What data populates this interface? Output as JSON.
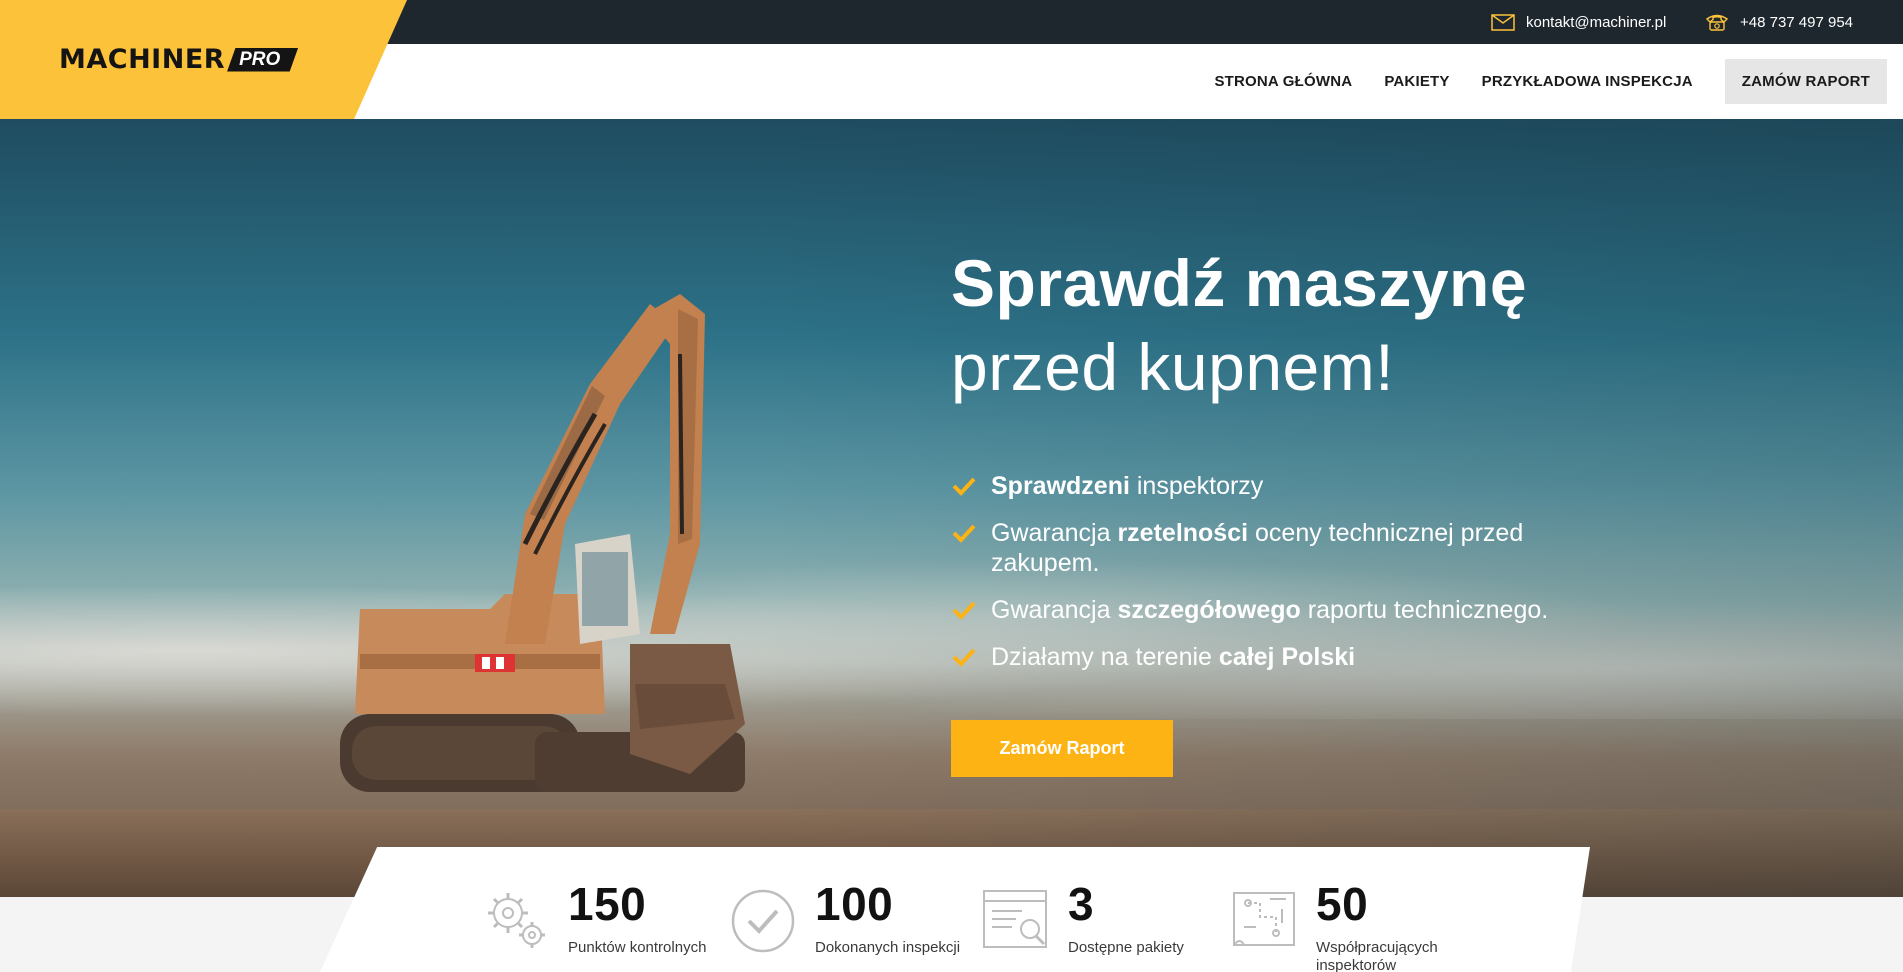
{
  "brand": {
    "name": "MACHINER",
    "suffix": "PRO"
  },
  "topbar": {
    "email": "kontakt@machiner.pl",
    "phone": "+48 737 497 954",
    "icons": {
      "email": "envelope-icon",
      "phone": "phone-icon"
    }
  },
  "nav": {
    "items": [
      {
        "label": "STRONA GŁÓWNA"
      },
      {
        "label": "PAKIETY"
      },
      {
        "label": "PRZYKŁADOWA INSPEKCJA"
      }
    ],
    "cta": "ZAMÓW RAPORT"
  },
  "hero": {
    "title_line1": "Sprawdź maszynę",
    "title_line2": "przed kupnem!",
    "features": [
      {
        "pre": "",
        "bold": "Sprawdzeni",
        "post": " inspektorzy"
      },
      {
        "pre": "Gwarancja ",
        "bold": "rzetelności",
        "post": " oceny technicznej przed zakupem."
      },
      {
        "pre": "Gwarancja ",
        "bold": "szczegółowego",
        "post": " raportu technicznego."
      },
      {
        "pre": "Działamy na terenie ",
        "bold": "całej Polski",
        "post": ""
      }
    ],
    "button": "Zamów Raport"
  },
  "stats": [
    {
      "number": "150",
      "label": "Punktów kontrolnych",
      "icon": "gears-icon"
    },
    {
      "number": "100",
      "label": "Dokonanych inspekcji",
      "icon": "check-circle-icon"
    },
    {
      "number": "3",
      "label": "Dostępne pakiety",
      "icon": "search-document-icon"
    },
    {
      "number": "50",
      "label": "Współpracujących inspektorów",
      "icon": "map-icon"
    }
  ],
  "colors": {
    "accent": "#fcc23a",
    "button": "#fcb313",
    "topbar": "#1e272e"
  }
}
